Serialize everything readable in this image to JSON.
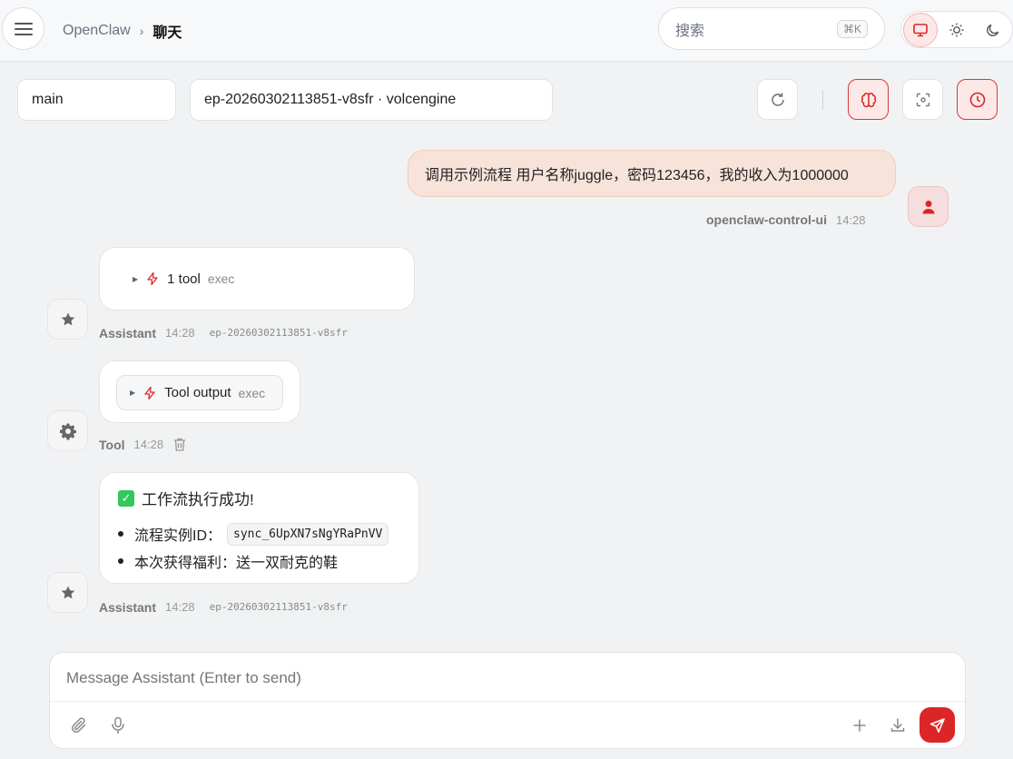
{
  "header": {
    "app_name": "OpenClaw",
    "separator": "›",
    "page_title": "聊天",
    "search_placeholder": "搜索",
    "search_shortcut": "⌘K"
  },
  "session": {
    "agent": "main",
    "model": "ep-20260302113851-v8sfr · volcengine"
  },
  "messages": [
    {
      "role": "user",
      "text": "调用示例流程 用户名称juggle，密码123456，我的收入为1000000",
      "sender": "openclaw-control-ui",
      "time": "14:28"
    },
    {
      "role": "assistant",
      "tool_count": "1 tool",
      "tool_name": "exec",
      "sender": "Assistant",
      "time": "14:28",
      "model": "ep-20260302113851-v8sfr"
    },
    {
      "role": "tool",
      "label": "Tool output",
      "tool_name": "exec",
      "sender": "Tool",
      "time": "14:28"
    },
    {
      "role": "assistant",
      "title": "工作流执行成功!",
      "items": [
        {
          "label": "流程实例ID：",
          "code": "sync_6UpXN7sNgYRaPnVV"
        },
        {
          "label": "本次获得福利：送一双耐克的鞋"
        }
      ],
      "sender": "Assistant",
      "time": "14:28",
      "model": "ep-20260302113851-v8sfr"
    }
  ],
  "composer": {
    "placeholder": "Message Assistant (Enter to send)"
  },
  "colors": {
    "accent": "#dc2626",
    "user_bubble": "#f7e3da",
    "background": "#f1f2f3"
  }
}
